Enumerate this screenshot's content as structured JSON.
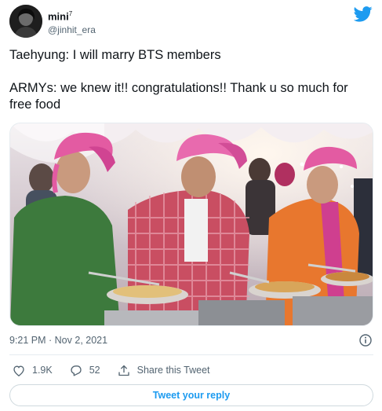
{
  "author": {
    "display_name": "mini",
    "superscript": "7",
    "handle": "@jinhit_era"
  },
  "tweet": {
    "line1": "Taehyung: I will marry BTS members",
    "line2": "ARMYs: we knew it!! congratulations!! Thank u so much for free food"
  },
  "meta": {
    "timestamp": "9:21 PM · Nov 2, 2021"
  },
  "actions": {
    "likes": "1.9K",
    "replies": "52",
    "share_label": "Share this Tweet"
  },
  "reply_button": {
    "label": "Tweet your reply"
  },
  "colors": {
    "accent": "#1d9bf0",
    "text": "#0f1419",
    "muted": "#536471",
    "border": "#cfd9de"
  },
  "icons": [
    "twitter-bird-icon",
    "info-icon",
    "heart-icon",
    "reply-bubble-icon",
    "share-icon"
  ]
}
